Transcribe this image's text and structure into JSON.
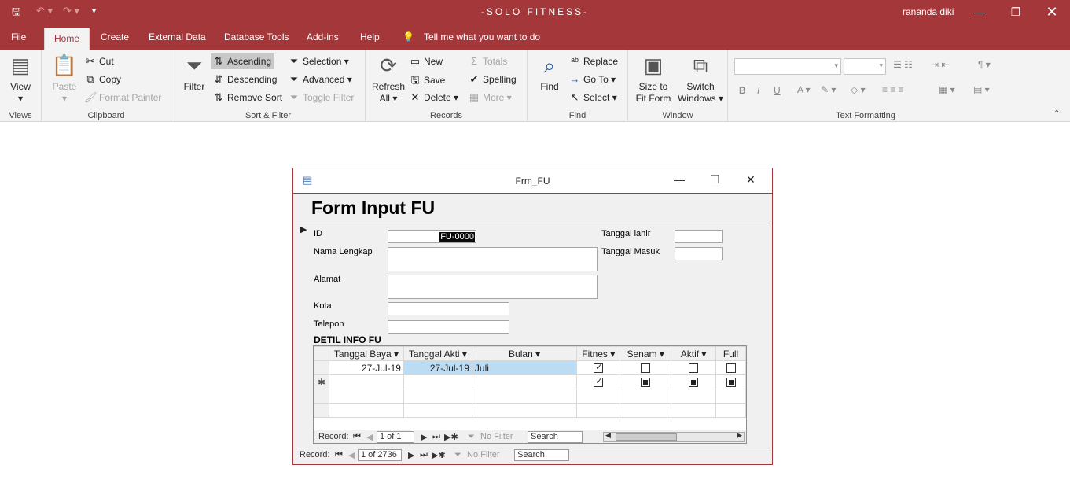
{
  "app": {
    "title": "-SOLO FITNESS-",
    "user": "rananda diki"
  },
  "tabs": [
    "File",
    "Home",
    "Create",
    "External Data",
    "Database Tools",
    "Add-ins",
    "Help"
  ],
  "tellme": "Tell me what you want to do",
  "ribbon": {
    "views": {
      "view": "View",
      "label": "Views"
    },
    "clipboard": {
      "paste": "Paste",
      "cut": "Cut",
      "copy": "Copy",
      "format_painter": "Format Painter",
      "label": "Clipboard"
    },
    "sort": {
      "filter": "Filter",
      "ascending": "Ascending",
      "descending": "Descending",
      "remove_sort": "Remove Sort",
      "selection": "Selection",
      "advanced": "Advanced",
      "toggle_filter": "Toggle Filter",
      "label": "Sort & Filter"
    },
    "records": {
      "refresh": "Refresh",
      "refresh2": "All",
      "new": "New",
      "save": "Save",
      "delete": "Delete",
      "totals": "Totals",
      "spelling": "Spelling",
      "more": "More",
      "label": "Records"
    },
    "find": {
      "find": "Find",
      "replace": "Replace",
      "goto": "Go To",
      "select": "Select",
      "label": "Find"
    },
    "window": {
      "size": "Size to",
      "size2": "Fit Form",
      "switch": "Switch",
      "switch2": "Windows",
      "label": "Window"
    },
    "text": {
      "label": "Text Formatting",
      "bold": "B",
      "italic": "I",
      "underline": "U"
    }
  },
  "form": {
    "caption": "Frm_FU",
    "title": "Form Input FU",
    "fields": {
      "id": "ID",
      "id_value": "FU-0000",
      "nama": "Nama Lengkap",
      "alamat": "Alamat",
      "kota": "Kota",
      "telepon": "Telepon",
      "tgl_lahir": "Tanggal lahir",
      "tgl_masuk": "Tanggal Masuk"
    },
    "detail_title": "DETIL INFO FU",
    "columns": [
      "Tanggal Baya",
      "Tanggal Akti",
      "Bulan",
      "Fitnes",
      "Senam",
      "Aktif",
      "Full"
    ],
    "rows": [
      {
        "tgl_bayar": "27-Jul-19",
        "tgl_aktif": "27-Jul-19",
        "bulan": "Juli",
        "fitnes": "checked",
        "senam": "unchecked",
        "aktif": "unchecked",
        "full": "unchecked"
      }
    ],
    "new_row_marker": "✱",
    "subnav": {
      "record": "Record:",
      "position": "1 of 1",
      "nofilter": "No Filter",
      "search": "Search"
    },
    "mainnav": {
      "record": "Record:",
      "position": "1 of 2736",
      "nofilter": "No Filter",
      "search": "Search"
    }
  }
}
